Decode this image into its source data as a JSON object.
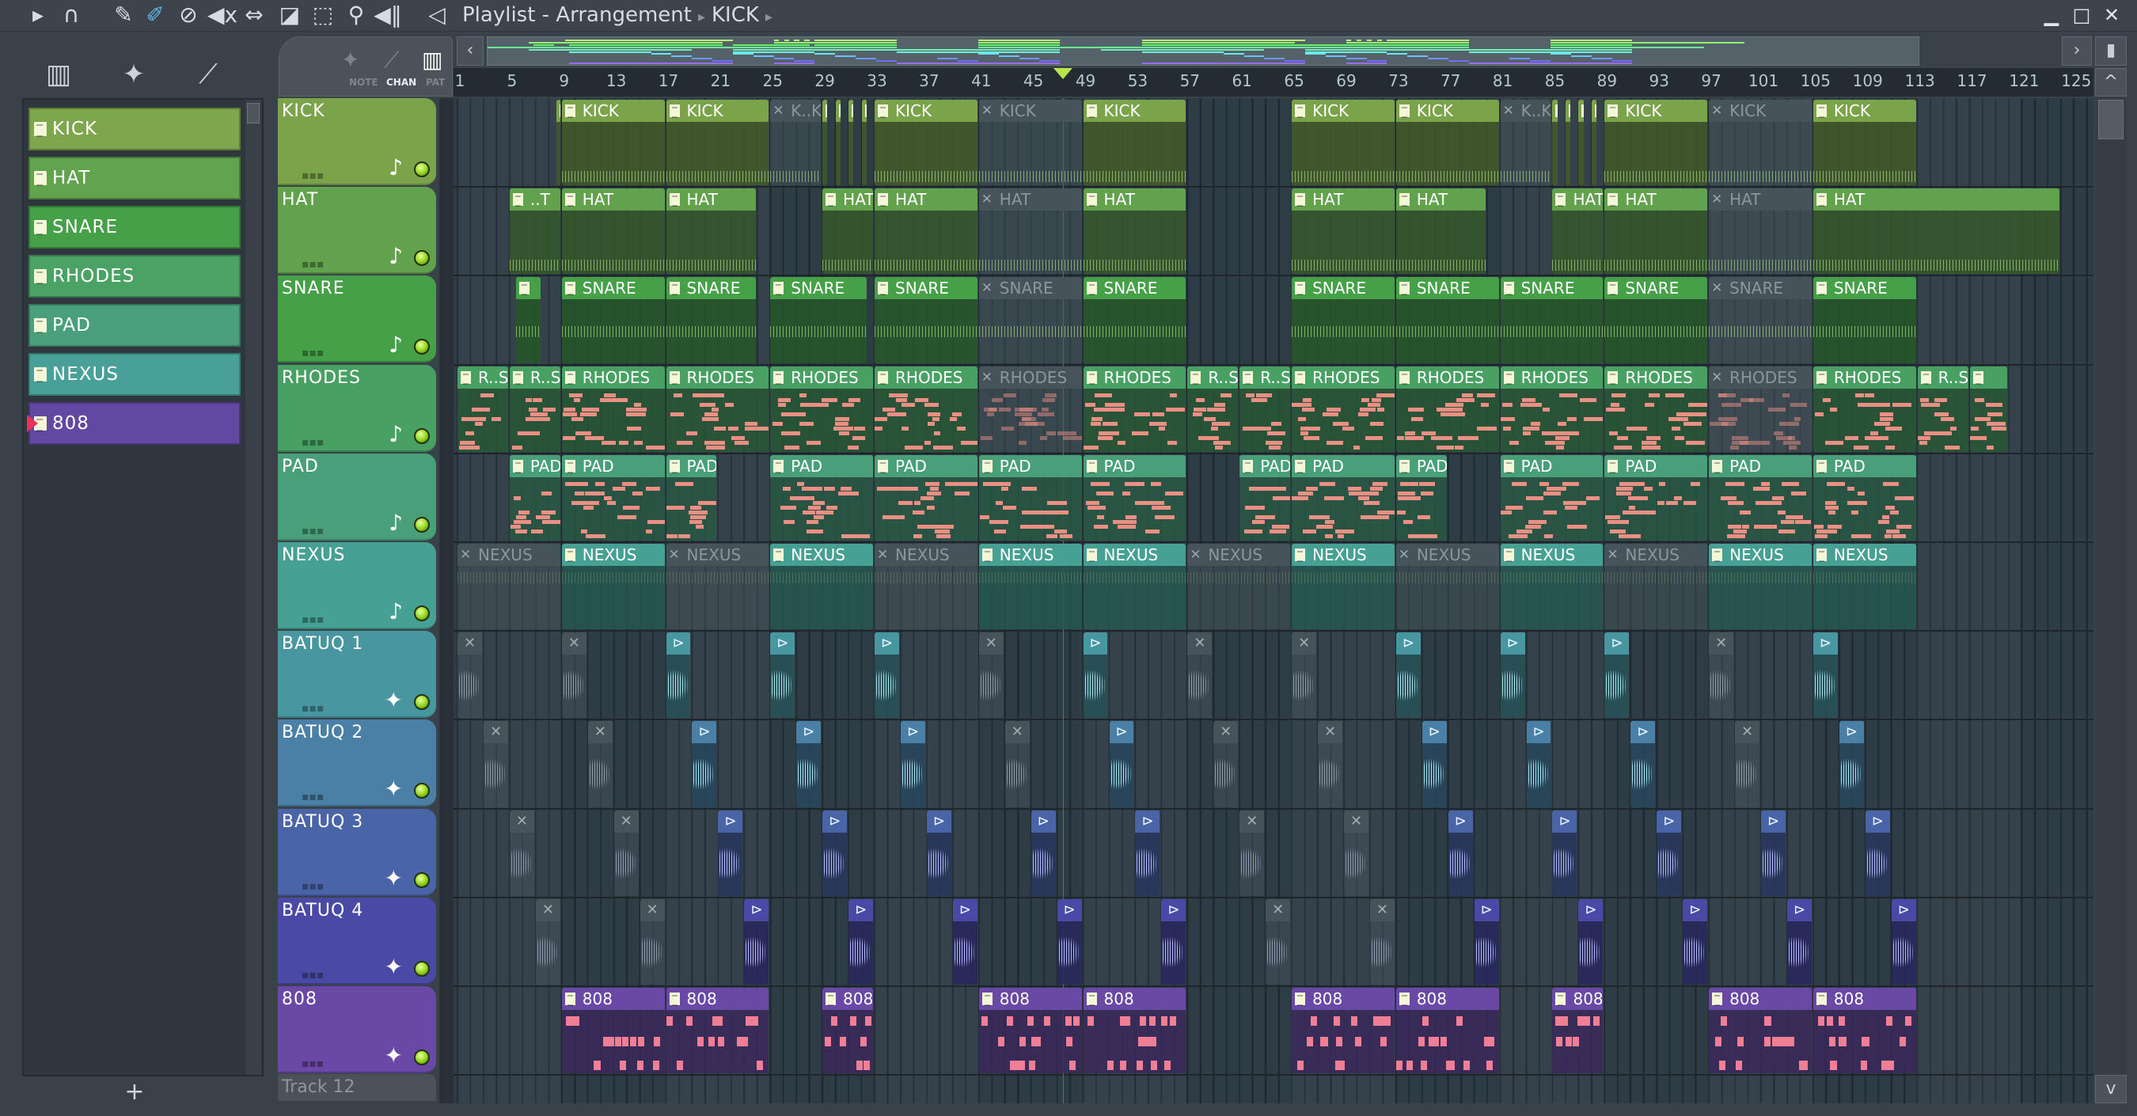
{
  "titlebar": {
    "title": "Playlist - Arrangement",
    "breadcrumb": "KICK",
    "separator": "▸",
    "tools": [
      {
        "icon": "menu-arrow-icon",
        "glyph": "▸"
      },
      {
        "icon": "magnet-snap-icon",
        "glyph": "∩"
      },
      {
        "icon": "pencil-icon",
        "glyph": "✎"
      },
      {
        "icon": "brush-icon",
        "glyph": "✐"
      },
      {
        "icon": "delete-icon",
        "glyph": "⊘"
      },
      {
        "icon": "mute-icon",
        "glyph": "◀x"
      },
      {
        "icon": "slip-icon",
        "glyph": "⇔"
      },
      {
        "icon": "slice-icon",
        "glyph": "◪"
      },
      {
        "icon": "select-icon",
        "glyph": "⬚"
      },
      {
        "icon": "zoom-icon",
        "glyph": "⚲"
      },
      {
        "icon": "playback-icon",
        "glyph": "◀‖"
      }
    ],
    "speaker_glyph": "◁",
    "window": {
      "minimize": "▁",
      "maximize": "□",
      "close": "✕"
    }
  },
  "picker": {
    "icons": [
      "▥",
      "✦",
      "⟋"
    ],
    "items": [
      {
        "label": "KICK",
        "color": "#7ea64c"
      },
      {
        "label": "HAT",
        "color": "#62a34e"
      },
      {
        "label": "SNARE",
        "color": "#46a047"
      },
      {
        "label": "RHODES",
        "color": "#4aa265"
      },
      {
        "label": "PAD",
        "color": "#4aa07c"
      },
      {
        "label": "NEXUS",
        "color": "#48a098"
      },
      {
        "label": "808",
        "color": "#6248a0",
        "selected": true
      }
    ],
    "add": "+"
  },
  "header_tab": {
    "icons": [
      "✦",
      "⟋",
      "▥"
    ],
    "note": "NOTE",
    "chan": "CHAN",
    "pat": "PAT"
  },
  "nav": {
    "left": "‹",
    "right": "›",
    "up": "^",
    "down": "v",
    "end": "▮"
  },
  "ruler": {
    "labels": [
      "1",
      "5",
      "9",
      "13",
      "17",
      "21",
      "25",
      "29",
      "33",
      "37",
      "41",
      "45",
      "49",
      "53",
      "57",
      "61",
      "65",
      "69",
      "73",
      "77",
      "81",
      "85",
      "89",
      "93",
      "97",
      "101",
      "105",
      "109",
      "113",
      "117",
      "121",
      "125"
    ]
  },
  "playhead_bar": 47.5,
  "tracks": [
    {
      "name": "KICK",
      "color": "#7ba44a",
      "icon": "♪",
      "clips": [
        {
          "start": 8.6,
          "len": 0.4,
          "label": ""
        },
        {
          "start": 9,
          "len": 8,
          "label": "KICK"
        },
        {
          "start": 17,
          "len": 8,
          "label": "KICK"
        },
        {
          "start": 25,
          "len": 4,
          "label": "K..K",
          "muted": true
        },
        {
          "start": 29,
          "len": 0.5,
          "label": ""
        },
        {
          "start": 30,
          "len": 0.5,
          "label": ""
        },
        {
          "start": 31,
          "len": 0.5,
          "label": ""
        },
        {
          "start": 32,
          "len": 0.5,
          "label": ""
        },
        {
          "start": 33,
          "len": 8,
          "label": "KICK"
        },
        {
          "start": 41,
          "len": 8,
          "label": "KICK",
          "muted": true
        },
        {
          "start": 49,
          "len": 8,
          "label": "KICK"
        },
        {
          "start": 65,
          "len": 8,
          "label": "KICK"
        },
        {
          "start": 73,
          "len": 8,
          "label": "KICK"
        },
        {
          "start": 81,
          "len": 4,
          "label": "K..K",
          "muted": true
        },
        {
          "start": 85,
          "len": 0.5,
          "label": ""
        },
        {
          "start": 86,
          "len": 0.5,
          "label": ""
        },
        {
          "start": 87,
          "len": 0.5,
          "label": ""
        },
        {
          "start": 88,
          "len": 0.5,
          "label": ""
        },
        {
          "start": 89,
          "len": 8,
          "label": "KICK"
        },
        {
          "start": 97,
          "len": 8,
          "label": "KICK",
          "muted": true
        },
        {
          "start": 105,
          "len": 8,
          "label": "KICK"
        }
      ]
    },
    {
      "name": "HAT",
      "color": "#62a24d",
      "icon": "♪",
      "clips": [
        {
          "start": 5,
          "len": 4,
          "label": "..T"
        },
        {
          "start": 9,
          "len": 8,
          "label": "HAT"
        },
        {
          "start": 17,
          "len": 7,
          "label": "HAT"
        },
        {
          "start": 29,
          "len": 4,
          "label": "HAT"
        },
        {
          "start": 33,
          "len": 8,
          "label": "HAT"
        },
        {
          "start": 41,
          "len": 8,
          "label": "HAT",
          "muted": true
        },
        {
          "start": 49,
          "len": 8,
          "label": "HAT"
        },
        {
          "start": 65,
          "len": 8,
          "label": "HAT"
        },
        {
          "start": 73,
          "len": 7,
          "label": "HAT"
        },
        {
          "start": 85,
          "len": 4,
          "label": "HAT"
        },
        {
          "start": 89,
          "len": 8,
          "label": "HAT"
        },
        {
          "start": 97,
          "len": 8,
          "label": "HAT",
          "muted": true
        },
        {
          "start": 105,
          "len": 19,
          "label": "HAT"
        }
      ]
    },
    {
      "name": "SNARE",
      "color": "#45a048",
      "icon": "♪",
      "clips": [
        {
          "start": 5.5,
          "len": 2,
          "label": ""
        },
        {
          "start": 9,
          "len": 8,
          "label": "SNARE"
        },
        {
          "start": 17,
          "len": 7,
          "label": "SNARE"
        },
        {
          "start": 25,
          "len": 7.5,
          "label": "SNARE"
        },
        {
          "start": 33,
          "len": 8,
          "label": "SNARE"
        },
        {
          "start": 41,
          "len": 8,
          "label": "SNARE",
          "muted": true
        },
        {
          "start": 49,
          "len": 8,
          "label": "SNARE"
        },
        {
          "start": 65,
          "len": 8,
          "label": "SNARE"
        },
        {
          "start": 73,
          "len": 8,
          "label": "SNARE"
        },
        {
          "start": 81,
          "len": 8,
          "label": "SNARE"
        },
        {
          "start": 89,
          "len": 8,
          "label": "SNARE"
        },
        {
          "start": 97,
          "len": 8,
          "label": "SNARE",
          "muted": true
        },
        {
          "start": 105,
          "len": 8,
          "label": "SNARE"
        }
      ]
    },
    {
      "name": "RHODES",
      "color": "#48a062",
      "icon": "♪",
      "clips": [
        {
          "start": 1,
          "len": 4,
          "label": "R..S"
        },
        {
          "start": 5,
          "len": 4,
          "label": "R..S"
        },
        {
          "start": 9,
          "len": 8,
          "label": "RHODES"
        },
        {
          "start": 17,
          "len": 8,
          "label": "RHODES"
        },
        {
          "start": 25,
          "len": 8,
          "label": "RHODES"
        },
        {
          "start": 33,
          "len": 8,
          "label": "RHODES"
        },
        {
          "start": 41,
          "len": 8,
          "label": "RHODES",
          "muted": true
        },
        {
          "start": 49,
          "len": 8,
          "label": "RHODES"
        },
        {
          "start": 57,
          "len": 4,
          "label": "R..S"
        },
        {
          "start": 61,
          "len": 4,
          "label": "R..S"
        },
        {
          "start": 65,
          "len": 8,
          "label": "RHODES"
        },
        {
          "start": 73,
          "len": 8,
          "label": "RHODES"
        },
        {
          "start": 81,
          "len": 8,
          "label": "RHODES"
        },
        {
          "start": 89,
          "len": 8,
          "label": "RHODES"
        },
        {
          "start": 97,
          "len": 8,
          "label": "RHODES",
          "muted": true
        },
        {
          "start": 105,
          "len": 8,
          "label": "RHODES"
        },
        {
          "start": 113,
          "len": 4,
          "label": "R..S"
        },
        {
          "start": 117,
          "len": 3,
          "label": ""
        }
      ]
    },
    {
      "name": "PAD",
      "color": "#49a078",
      "icon": "♪",
      "clips": [
        {
          "start": 5,
          "len": 4,
          "label": "PAD"
        },
        {
          "start": 9,
          "len": 8,
          "label": "PAD"
        },
        {
          "start": 17,
          "len": 4,
          "label": "PAD"
        },
        {
          "start": 25,
          "len": 8,
          "label": "PAD"
        },
        {
          "start": 33,
          "len": 8,
          "label": "PAD"
        },
        {
          "start": 41,
          "len": 8,
          "label": "PAD"
        },
        {
          "start": 49,
          "len": 8,
          "label": "PAD"
        },
        {
          "start": 61,
          "len": 4,
          "label": "PAD"
        },
        {
          "start": 65,
          "len": 8,
          "label": "PAD"
        },
        {
          "start": 73,
          "len": 4,
          "label": "PAD"
        },
        {
          "start": 81,
          "len": 8,
          "label": "PAD"
        },
        {
          "start": 89,
          "len": 8,
          "label": "PAD"
        },
        {
          "start": 97,
          "len": 8,
          "label": "PAD"
        },
        {
          "start": 105,
          "len": 8,
          "label": "PAD"
        }
      ]
    },
    {
      "name": "NEXUS",
      "color": "#46a094",
      "icon": "♪",
      "clips": [
        {
          "start": 1,
          "len": 8,
          "label": "NEXUS",
          "muted": true
        },
        {
          "start": 9,
          "len": 8,
          "label": "NEXUS"
        },
        {
          "start": 17,
          "len": 8,
          "label": "NEXUS",
          "muted": true
        },
        {
          "start": 25,
          "len": 8,
          "label": "NEXUS"
        },
        {
          "start": 33,
          "len": 8,
          "label": "NEXUS",
          "muted": true
        },
        {
          "start": 41,
          "len": 8,
          "label": "NEXUS"
        },
        {
          "start": 49,
          "len": 8,
          "label": "NEXUS"
        },
        {
          "start": 57,
          "len": 8,
          "label": "NEXUS",
          "muted": true
        },
        {
          "start": 65,
          "len": 8,
          "label": "NEXUS"
        },
        {
          "start": 73,
          "len": 8,
          "label": "NEXUS",
          "muted": true
        },
        {
          "start": 81,
          "len": 8,
          "label": "NEXUS"
        },
        {
          "start": 89,
          "len": 8,
          "label": "NEXUS",
          "muted": true
        },
        {
          "start": 97,
          "len": 8,
          "label": "NEXUS"
        },
        {
          "start": 105,
          "len": 8,
          "label": "NEXUS"
        }
      ]
    },
    {
      "name": "BATUQ 1",
      "color": "#4896a0",
      "icon": "✦",
      "audio": true,
      "clips": [
        {
          "start": 1,
          "len": 2,
          "muted": true
        },
        {
          "start": 9,
          "len": 2,
          "muted": true
        },
        {
          "start": 17,
          "len": 2
        },
        {
          "start": 25,
          "len": 2
        },
        {
          "start": 33,
          "len": 2
        },
        {
          "start": 41,
          "len": 2,
          "muted": true
        },
        {
          "start": 49,
          "len": 2
        },
        {
          "start": 57,
          "len": 2,
          "muted": true
        },
        {
          "start": 65,
          "len": 2,
          "muted": true
        },
        {
          "start": 73,
          "len": 2
        },
        {
          "start": 81,
          "len": 2
        },
        {
          "start": 89,
          "len": 2
        },
        {
          "start": 97,
          "len": 2,
          "muted": true
        },
        {
          "start": 105,
          "len": 2
        }
      ]
    },
    {
      "name": "BATUQ 2",
      "color": "#4a80a6",
      "icon": "✦",
      "audio": true,
      "clips": [
        {
          "start": 3,
          "len": 2,
          "muted": true
        },
        {
          "start": 11,
          "len": 2,
          "muted": true
        },
        {
          "start": 19,
          "len": 2
        },
        {
          "start": 27,
          "len": 2
        },
        {
          "start": 35,
          "len": 2
        },
        {
          "start": 43,
          "len": 2,
          "muted": true
        },
        {
          "start": 51,
          "len": 2
        },
        {
          "start": 59,
          "len": 2,
          "muted": true
        },
        {
          "start": 67,
          "len": 2,
          "muted": true
        },
        {
          "start": 75,
          "len": 2
        },
        {
          "start": 83,
          "len": 2
        },
        {
          "start": 91,
          "len": 2
        },
        {
          "start": 99,
          "len": 2,
          "muted": true
        },
        {
          "start": 107,
          "len": 2
        }
      ]
    },
    {
      "name": "BATUQ 3",
      "color": "#4a64a8",
      "icon": "✦",
      "audio": true,
      "clips": [
        {
          "start": 5,
          "len": 2,
          "muted": true
        },
        {
          "start": 13,
          "len": 2,
          "muted": true
        },
        {
          "start": 21,
          "len": 2
        },
        {
          "start": 29,
          "len": 2
        },
        {
          "start": 37,
          "len": 2
        },
        {
          "start": 45,
          "len": 2
        },
        {
          "start": 53,
          "len": 2
        },
        {
          "start": 61,
          "len": 2,
          "muted": true
        },
        {
          "start": 69,
          "len": 2,
          "muted": true
        },
        {
          "start": 77,
          "len": 2
        },
        {
          "start": 85,
          "len": 2
        },
        {
          "start": 93,
          "len": 2
        },
        {
          "start": 101,
          "len": 2
        },
        {
          "start": 109,
          "len": 2
        }
      ]
    },
    {
      "name": "BATUQ 4",
      "color": "#4a4aa6",
      "icon": "✦",
      "audio": true,
      "clips": [
        {
          "start": 7,
          "len": 2,
          "muted": true
        },
        {
          "start": 15,
          "len": 2,
          "muted": true
        },
        {
          "start": 23,
          "len": 2
        },
        {
          "start": 31,
          "len": 2
        },
        {
          "start": 39,
          "len": 2
        },
        {
          "start": 47,
          "len": 2
        },
        {
          "start": 55,
          "len": 2
        },
        {
          "start": 63,
          "len": 2,
          "muted": true
        },
        {
          "start": 71,
          "len": 2,
          "muted": true
        },
        {
          "start": 79,
          "len": 2
        },
        {
          "start": 87,
          "len": 2
        },
        {
          "start": 95,
          "len": 2
        },
        {
          "start": 103,
          "len": 2
        },
        {
          "start": 111,
          "len": 2
        }
      ]
    },
    {
      "name": "808",
      "color": "#6a48a6",
      "icon": "✦",
      "clips": [
        {
          "start": 9,
          "len": 8,
          "label": "808"
        },
        {
          "start": 17,
          "len": 8,
          "label": "808"
        },
        {
          "start": 29,
          "len": 4,
          "label": "808"
        },
        {
          "start": 41,
          "len": 8,
          "label": "808"
        },
        {
          "start": 49,
          "len": 8,
          "label": "808"
        },
        {
          "start": 65,
          "len": 8,
          "label": "808"
        },
        {
          "start": 73,
          "len": 8,
          "label": "808"
        },
        {
          "start": 85,
          "len": 4,
          "label": "808"
        },
        {
          "start": 97,
          "len": 8,
          "label": "808"
        },
        {
          "start": 105,
          "len": 8,
          "label": "808"
        }
      ]
    }
  ],
  "empty_track": "Track 12"
}
